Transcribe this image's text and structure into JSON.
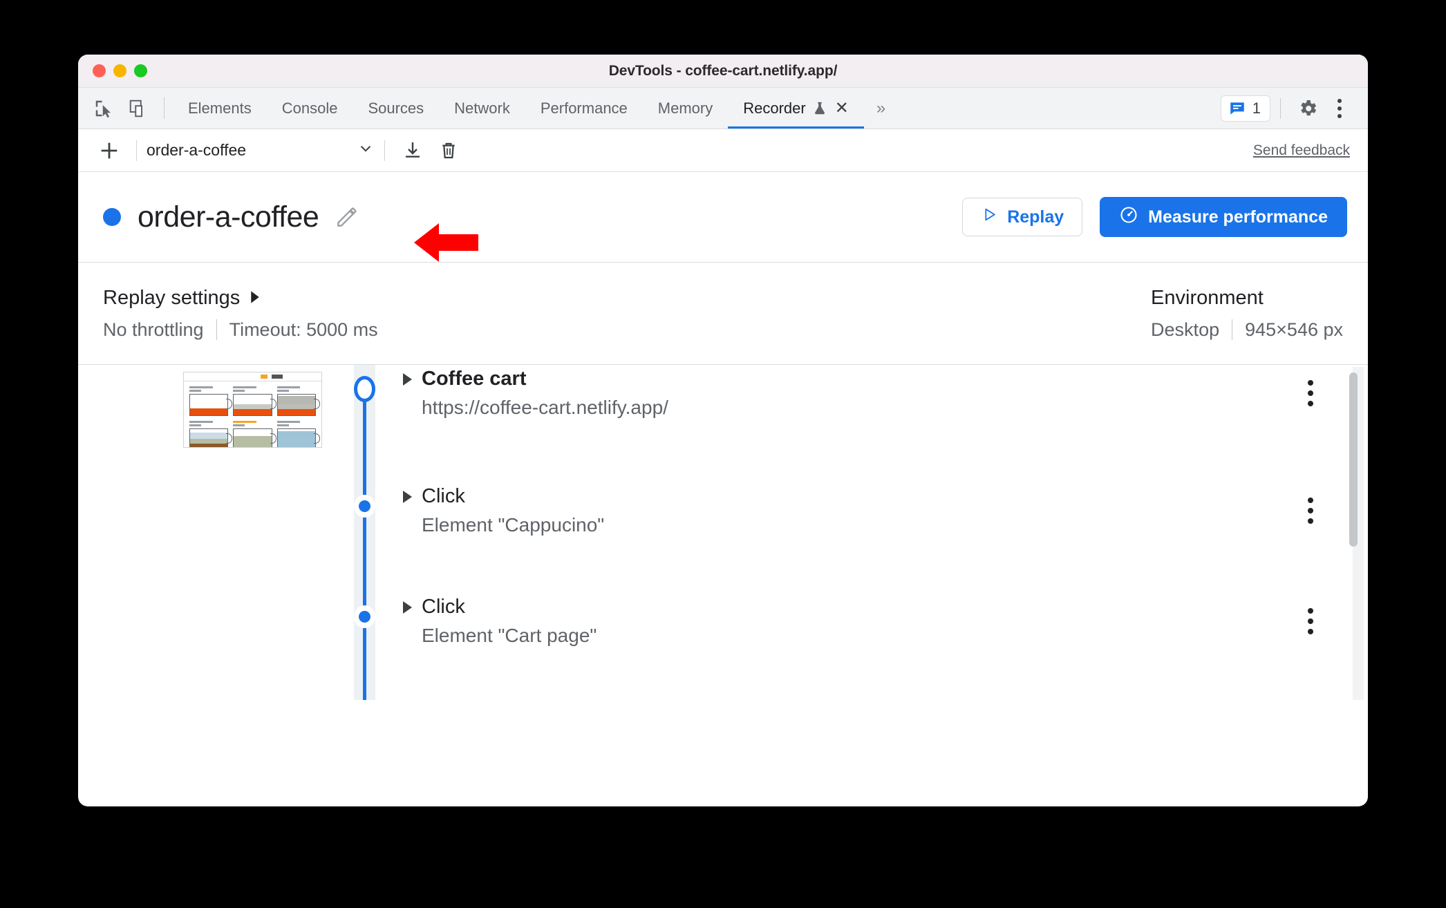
{
  "window": {
    "title": "DevTools - coffee-cart.netlify.app/",
    "traffic_lights": [
      "close",
      "minimize",
      "maximize"
    ]
  },
  "tabstrip": {
    "left_icons": [
      "inspect-element-icon",
      "device-toolbar-icon"
    ],
    "tabs": [
      {
        "label": "Elements",
        "active": false
      },
      {
        "label": "Console",
        "active": false
      },
      {
        "label": "Sources",
        "active": false
      },
      {
        "label": "Network",
        "active": false
      },
      {
        "label": "Performance",
        "active": false
      },
      {
        "label": "Memory",
        "active": false
      },
      {
        "label": "Recorder",
        "active": true,
        "experimental": true,
        "closable": true
      }
    ],
    "overflow": "»",
    "message_count": "1",
    "right_icons": [
      "settings-gear-icon",
      "more-options-kebab-icon"
    ]
  },
  "recorder_toolbar": {
    "add_label": "+",
    "selected_recording": "order-a-coffee",
    "actions": [
      "export-icon",
      "delete-icon"
    ],
    "feedback_link": "Send feedback"
  },
  "recording_header": {
    "title": "order-a-coffee",
    "edit_icon": "pencil-icon",
    "status_color": "#1a73e8",
    "replay_label": "Replay",
    "measure_label": "Measure performance",
    "accent_color": "#1a73e8"
  },
  "settings": {
    "replay": {
      "heading": "Replay settings",
      "throttling": "No throttling",
      "timeout": "Timeout: 5000 ms"
    },
    "environment": {
      "heading": "Environment",
      "device": "Desktop",
      "viewport": "945×546 px"
    }
  },
  "steps": [
    {
      "marker": "ring",
      "title": "Coffee cart",
      "subtitle": "https://coffee-cart.netlify.app/",
      "bold": true,
      "has_thumbnail": true
    },
    {
      "marker": "dot",
      "title": "Click",
      "subtitle": "Element \"Cappucino\"",
      "bold": false,
      "has_thumbnail": false
    },
    {
      "marker": "dot",
      "title": "Click",
      "subtitle": "Element \"Cart page\"",
      "bold": false,
      "has_thumbnail": false
    }
  ],
  "annotation": {
    "type": "red-arrow",
    "direction": "left",
    "color": "#ff0000",
    "points_at": "edit-recording-name-pencil"
  }
}
